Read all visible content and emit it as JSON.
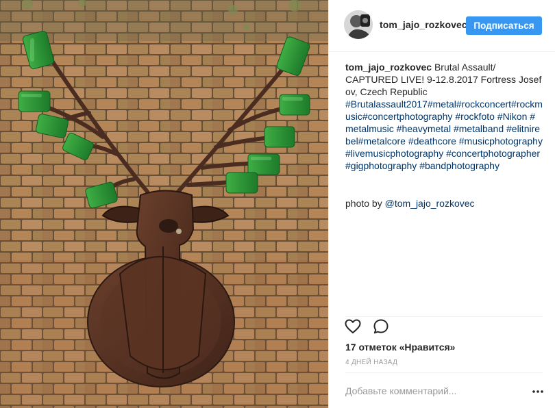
{
  "post": {
    "image_alt": "Metal deer head sculpture with green bottle antlers on a brick wall",
    "header_username": "tom_jajo_rozkovec",
    "follow_label": "Подписаться",
    "caption": {
      "author": "tom_jajo_rozkovec",
      "text_lines": [
        " Brutal Assault/",
        "CAPTURED LIVE! 9-12.8.2017 Fortress Josefov, Czech Republic"
      ],
      "hashtags_text": "#Brutalassault2017#metal#rockconcert#rockmusic#concertphotography #rockfoto #Nikon #metalmusic #heavymetal #metalband #elitnirebel#metalcore #deathcore #musicphotography #livemusicphotography #concertphotographer #gigphotography #bandphotography"
    },
    "credit": {
      "prefix": "photo by ",
      "mention": "@tom_jajo_rozkovec"
    },
    "likes_text": "17 отметок «Нравится»",
    "timestamp": "4 ДНЕЙ НАЗАД",
    "comment_placeholder": "Добавьте комментарий...",
    "icons": {
      "like": "heart-outline-icon",
      "comment": "speech-bubble-icon",
      "more": "ellipsis-icon"
    },
    "colors": {
      "accent": "#3897f0",
      "hashtag": "#003569",
      "muted": "#999999",
      "text": "#262626"
    }
  }
}
